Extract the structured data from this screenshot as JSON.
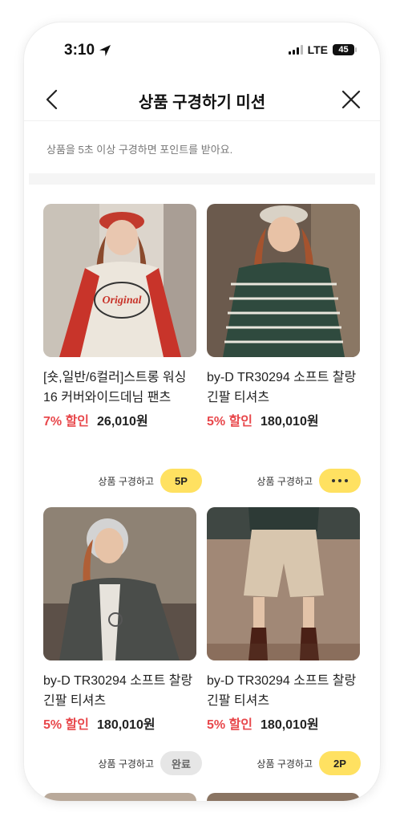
{
  "status": {
    "time": "3:10",
    "network": "LTE",
    "battery": "45"
  },
  "header": {
    "title": "상품 구경하기 미션"
  },
  "description": "상품을 5초 이상 구경하면 포인트를 받아요.",
  "products": [
    {
      "name": "[숏,일반/6컬러]스트롱 워싱16 커버와이드데님 팬츠",
      "discount": "7% 할인",
      "price": "26,010원",
      "action_label": "상품 구경하고",
      "badge": "5P",
      "state": "points"
    },
    {
      "name": "by-D TR30294 소프트 찰랑 긴팔 티셔츠",
      "discount": "5% 할인",
      "price": "180,010원",
      "action_label": "상품 구경하고",
      "badge": "",
      "state": "loading"
    },
    {
      "name": "by-D TR30294 소프트 찰랑 긴팔 티셔츠",
      "discount": "5% 할인",
      "price": "180,010원",
      "action_label": "상품 구경하고",
      "badge": "완료",
      "state": "done"
    },
    {
      "name": "by-D TR30294 소프트 찰랑 긴팔 티셔츠",
      "discount": "5% 할인",
      "price": "180,010원",
      "action_label": "상품 구경하고",
      "badge": "2P",
      "state": "points"
    }
  ],
  "colors": {
    "accent": "#ffe161",
    "discount": "#e8484c",
    "done": "#e6e6e6"
  }
}
